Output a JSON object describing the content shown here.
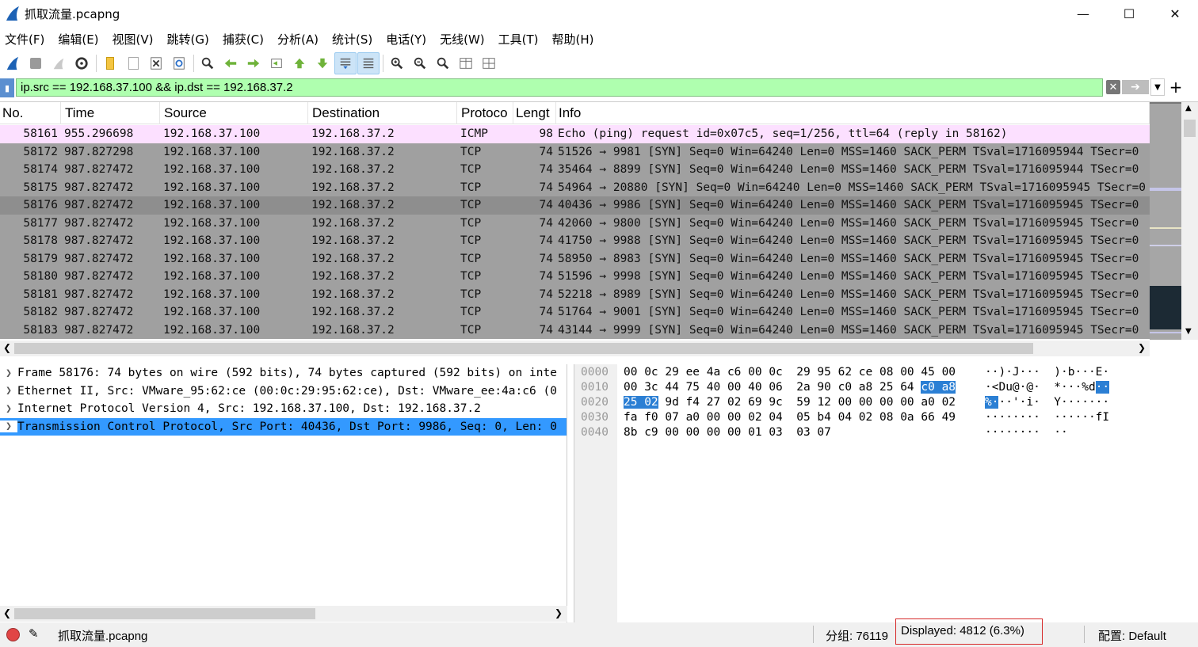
{
  "window": {
    "title": "抓取流量.pcapng"
  },
  "menu": [
    "文件(F)",
    "编辑(E)",
    "视图(V)",
    "跳转(G)",
    "捕获(C)",
    "分析(A)",
    "统计(S)",
    "电话(Y)",
    "无线(W)",
    "工具(T)",
    "帮助(H)"
  ],
  "filter": {
    "text": "ip.src == 192.168.37.100 && ip.dst == 192.168.37.2"
  },
  "columns": [
    "No.",
    "Time",
    "Source",
    "Destination",
    "Protoco",
    "Lengt",
    "Info"
  ],
  "packets": [
    [
      "58161",
      "955.296698",
      "192.168.37.100",
      "192.168.37.2",
      "ICMP",
      "98",
      "Echo (ping) request  id=0x07c5, seq=1/256, ttl=64 (reply in 58162)"
    ],
    [
      "58172",
      "987.827298",
      "192.168.37.100",
      "192.168.37.2",
      "TCP",
      "74",
      "51526 → 9981 [SYN] Seq=0 Win=64240 Len=0 MSS=1460 SACK_PERM TSval=1716095944 TSecr=0"
    ],
    [
      "58174",
      "987.827472",
      "192.168.37.100",
      "192.168.37.2",
      "TCP",
      "74",
      "35464 → 8899 [SYN] Seq=0 Win=64240 Len=0 MSS=1460 SACK_PERM TSval=1716095944 TSecr=0"
    ],
    [
      "58175",
      "987.827472",
      "192.168.37.100",
      "192.168.37.2",
      "TCP",
      "74",
      "54964 → 20880 [SYN] Seq=0 Win=64240 Len=0 MSS=1460 SACK_PERM TSval=1716095945 TSecr=0"
    ],
    [
      "58176",
      "987.827472",
      "192.168.37.100",
      "192.168.37.2",
      "TCP",
      "74",
      "40436 → 9986 [SYN] Seq=0 Win=64240 Len=0 MSS=1460 SACK_PERM TSval=1716095945 TSecr=0"
    ],
    [
      "58177",
      "987.827472",
      "192.168.37.100",
      "192.168.37.2",
      "TCP",
      "74",
      "42060 → 9800 [SYN] Seq=0 Win=64240 Len=0 MSS=1460 SACK_PERM TSval=1716095945 TSecr=0"
    ],
    [
      "58178",
      "987.827472",
      "192.168.37.100",
      "192.168.37.2",
      "TCP",
      "74",
      "41750 → 9988 [SYN] Seq=0 Win=64240 Len=0 MSS=1460 SACK_PERM TSval=1716095945 TSecr=0"
    ],
    [
      "58179",
      "987.827472",
      "192.168.37.100",
      "192.168.37.2",
      "TCP",
      "74",
      "58950 → 8983 [SYN] Seq=0 Win=64240 Len=0 MSS=1460 SACK_PERM TSval=1716095945 TSecr=0"
    ],
    [
      "58180",
      "987.827472",
      "192.168.37.100",
      "192.168.37.2",
      "TCP",
      "74",
      "51596 → 9998 [SYN] Seq=0 Win=64240 Len=0 MSS=1460 SACK_PERM TSval=1716095945 TSecr=0"
    ],
    [
      "58181",
      "987.827472",
      "192.168.37.100",
      "192.168.37.2",
      "TCP",
      "74",
      "52218 → 8989 [SYN] Seq=0 Win=64240 Len=0 MSS=1460 SACK_PERM TSval=1716095945 TSecr=0"
    ],
    [
      "58182",
      "987.827472",
      "192.168.37.100",
      "192.168.37.2",
      "TCP",
      "74",
      "51764 → 9001 [SYN] Seq=0 Win=64240 Len=0 MSS=1460 SACK_PERM TSval=1716095945 TSecr=0"
    ],
    [
      "58183",
      "987.827472",
      "192.168.37.100",
      "192.168.37.2",
      "TCP",
      "74",
      "43144 → 9999 [SYN] Seq=0 Win=64240 Len=0 MSS=1460 SACK_PERM TSval=1716095945 TSecr=0"
    ]
  ],
  "selected_packet": "58176",
  "detail_tree": [
    "Frame 58176: 74 bytes on wire (592 bits), 74 bytes captured (592 bits) on inte",
    "Ethernet II, Src: VMware_95:62:ce (00:0c:29:95:62:ce), Dst: VMware_ee:4a:c6 (0",
    "Internet Protocol Version 4, Src: 192.168.37.100, Dst: 192.168.37.2",
    "Transmission Control Protocol, Src Port: 40436, Dst Port: 9986, Seq: 0, Len: 0"
  ],
  "bytes": [
    {
      "offset": "0000",
      "hex": "00 0c 29 ee 4a c6 00 0c  29 95 62 ce 08 00 45 00",
      "hex_hl": "",
      "ascii": "··)·J···  )·b···E·",
      "ascii_hl": ""
    },
    {
      "offset": "0010",
      "hex": "00 3c 44 75 40 00 40 06  2a 90 c0 a8 25 64 ",
      "hex_hl": "c0 a8",
      "ascii": "·<Du@·@·  *···%d",
      "ascii_hl": "··"
    },
    {
      "offset": "0020",
      "hex_hl_pre": "25 02",
      "hex": " 9d f4 27 02 69 9c  59 12 00 00 00 00 a0 02",
      "ascii_hl_pre": "%·",
      "ascii": "··'·i·  Y·······"
    },
    {
      "offset": "0030",
      "hex": "fa f0 07 a0 00 00 02 04  05 b4 04 02 08 0a 66 49",
      "ascii": "········  ······fI"
    },
    {
      "offset": "0040",
      "hex": "8b c9 00 00 00 00 01 03  03 07",
      "ascii": "········  ··"
    }
  ],
  "status": {
    "file": "抓取流量.pcapng",
    "packets": "分组: 76119",
    "displayed": "Displayed: 4812 (6.3%)",
    "profile": "配置:  Default"
  },
  "colors": {
    "filter_bg": "#afffaf",
    "icmp_row": "#fce0ff",
    "tcp_row": "#a0a0a0",
    "selection": "#3399ff"
  }
}
